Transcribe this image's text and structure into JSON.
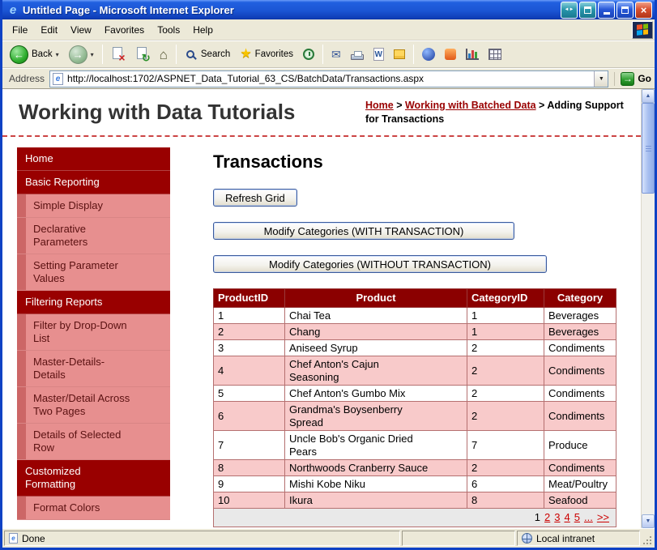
{
  "theme": {
    "xp_border_blue": "#0f42c4",
    "sidebar_red": "#990000",
    "sidebar_pink": "#e78f8f",
    "stripe_red": "#cc6666",
    "header_red": "#8b0000",
    "row_pink": "#f8caca",
    "link_red": "#990000",
    "pager_red": "#cc0000",
    "dash_red": "#cc4444",
    "flag_red": "#f35325",
    "flag_green": "#81bc06",
    "flag_blue": "#05a6f0",
    "flag_yellow": "#ffba08"
  },
  "window": {
    "title": "Untitled Page - Microsoft Internet Explorer"
  },
  "menu": {
    "items": [
      "File",
      "Edit",
      "View",
      "Favorites",
      "Tools",
      "Help"
    ]
  },
  "toolbar": {
    "back": "Back",
    "search": "Search",
    "favorites": "Favorites"
  },
  "address": {
    "label": "Address",
    "url": "http://localhost:1702/ASPNET_Data_Tutorial_63_CS/BatchData/Transactions.aspx",
    "go": "Go"
  },
  "icons": {
    "ie_e": "e",
    "back_arrow": "←",
    "forward_arrow": "→",
    "stop_x": "×",
    "refresh_arrows": "↻",
    "home_house": "⌂",
    "favorites_star": "★",
    "mail_envelope": "✉",
    "word_w": "W",
    "dropdown_chevron": "▾",
    "combo_arrow": "▼",
    "go_arrow": "→",
    "close_x": "×",
    "window_arrows": "◄►",
    "scroll_up": "▲",
    "scroll_down": "▼"
  },
  "header": {
    "site_title": "Working with Data Tutorials",
    "breadcrumb": {
      "link1": "Home",
      "sep1": " > ",
      "link2": "Working with Batched Data",
      "sep2": " > ",
      "current": "Adding Support for Transactions"
    }
  },
  "sidebar": {
    "items": [
      {
        "label": "Home",
        "type": "header"
      },
      {
        "label": "Basic Reporting",
        "type": "header"
      },
      {
        "label": "Simple Display",
        "type": "sub"
      },
      {
        "label": "Declarative Parameters",
        "type": "sub"
      },
      {
        "label": "Setting Parameter Values",
        "type": "sub"
      },
      {
        "label": "Filtering Reports",
        "type": "header"
      },
      {
        "label": "Filter by Drop-Down List",
        "type": "sub"
      },
      {
        "label": "Master-Details-Details",
        "type": "sub"
      },
      {
        "label": "Master/Detail Across Two Pages",
        "type": "sub"
      },
      {
        "label": "Details of Selected Row",
        "type": "sub"
      },
      {
        "label": "Customized Formatting",
        "type": "header"
      },
      {
        "label": "Format Colors",
        "type": "sub"
      }
    ]
  },
  "main": {
    "heading": "Transactions",
    "refresh_button": "Refresh Grid",
    "with_button": "Modify Categories (WITH TRANSACTION)",
    "without_button": "Modify Categories (WITHOUT TRANSACTION)"
  },
  "table": {
    "headers": [
      "ProductID",
      "Product",
      "CategoryID",
      "Category"
    ],
    "header_aligns": [
      "left",
      "center",
      "left",
      "center"
    ],
    "rows": [
      [
        "1",
        "Chai Tea",
        "1",
        "Beverages"
      ],
      [
        "2",
        "Chang",
        "1",
        "Beverages"
      ],
      [
        "3",
        "Aniseed Syrup",
        "2",
        "Condiments"
      ],
      [
        "4",
        "Chef Anton's Cajun Seasoning",
        "2",
        "Condiments"
      ],
      [
        "5",
        "Chef Anton's Gumbo Mix",
        "2",
        "Condiments"
      ],
      [
        "6",
        "Grandma's Boysenberry Spread",
        "2",
        "Condiments"
      ],
      [
        "7",
        "Uncle Bob's Organic Dried Pears",
        "7",
        "Produce"
      ],
      [
        "8",
        "Northwoods Cranberry Sauce",
        "2",
        "Condiments"
      ],
      [
        "9",
        "Mishi Kobe Niku",
        "6",
        "Meat/Poultry"
      ],
      [
        "10",
        "Ikura",
        "8",
        "Seafood"
      ]
    ],
    "pager": {
      "current": "1",
      "links": [
        "2",
        "3",
        "4",
        "5"
      ],
      "more": "...",
      "next": ">>"
    }
  },
  "status": {
    "left": "Done",
    "zone": "Local intranet"
  }
}
